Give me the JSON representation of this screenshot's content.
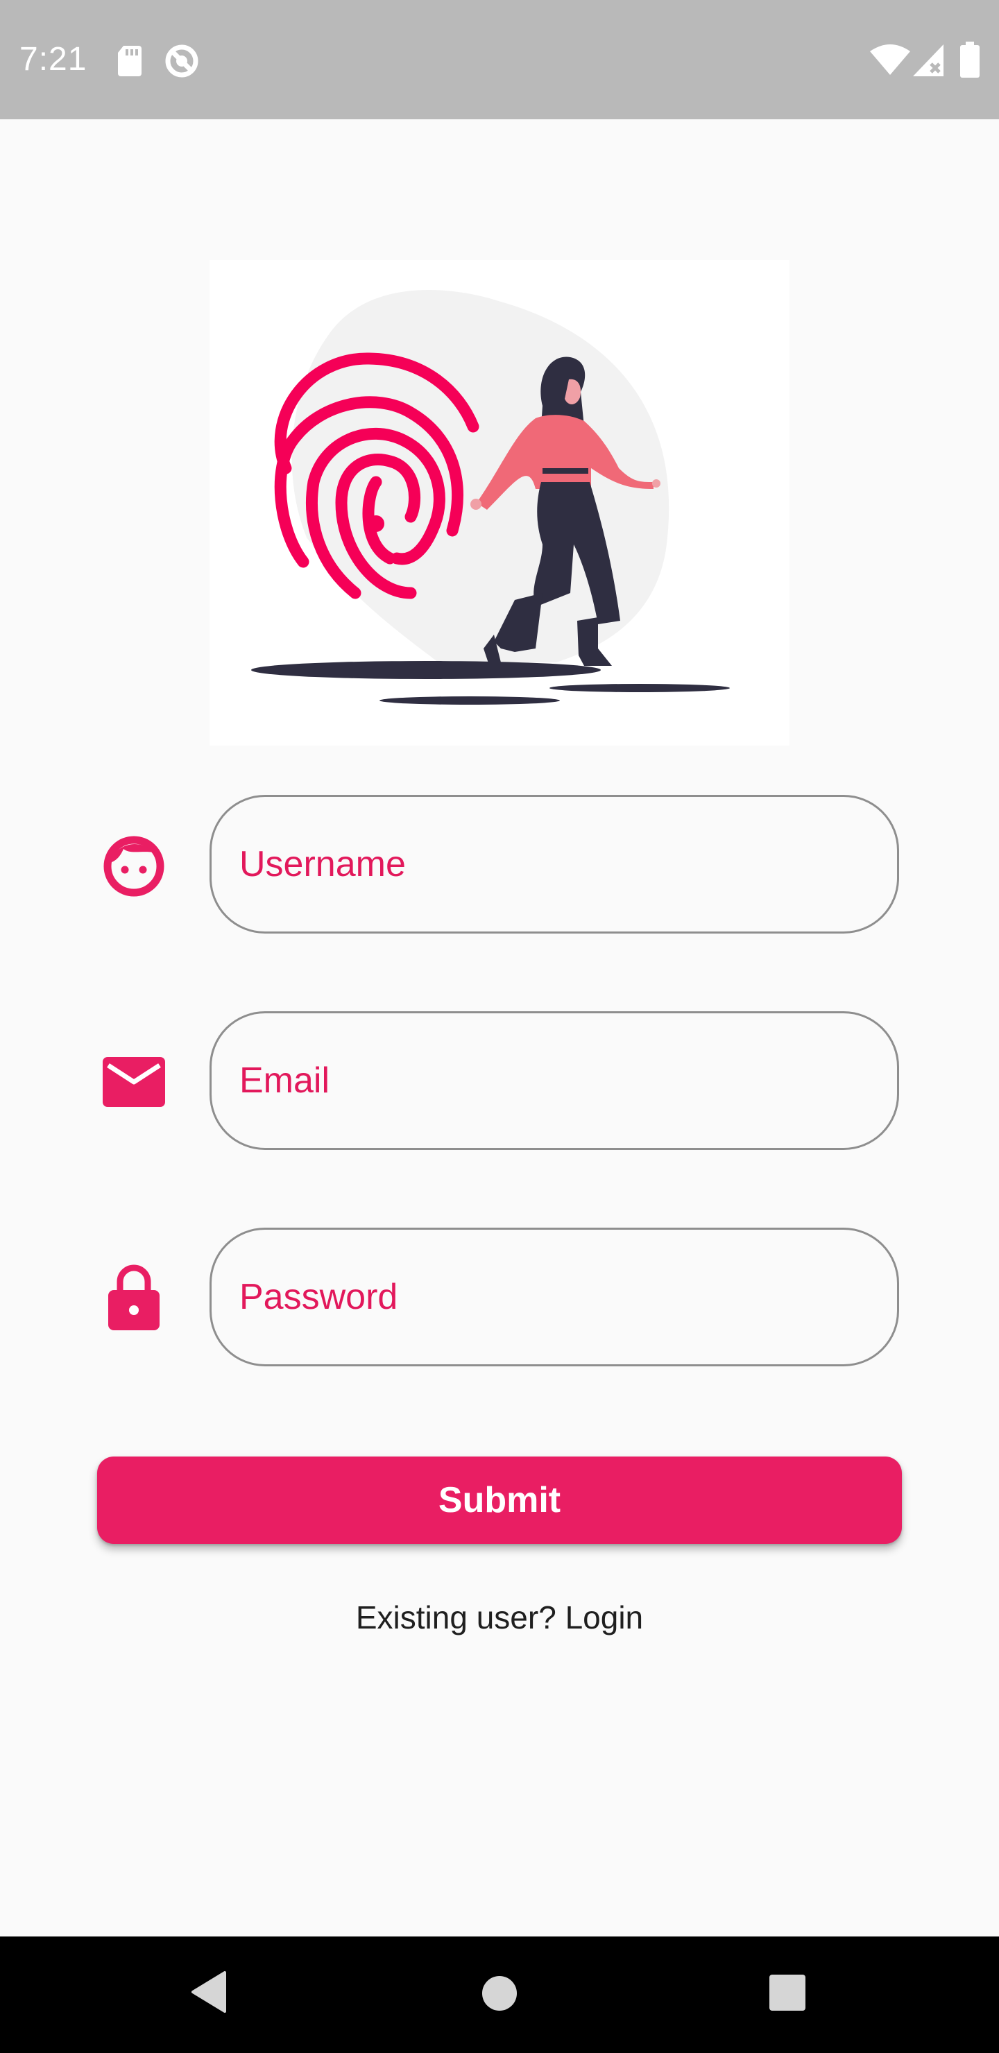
{
  "status_bar": {
    "time": "7:21",
    "icons": [
      "sd-card-icon",
      "do-not-disturb-icon",
      "wifi-icon",
      "signal-icon",
      "battery-icon"
    ]
  },
  "illustration": {
    "name": "fingerprint-woman-illustration",
    "colors": {
      "accent": "#f50057",
      "shirt": "#f06977",
      "dark": "#2f2e41",
      "blob": "#f2f2f2"
    }
  },
  "form": {
    "username": {
      "placeholder": "Username",
      "icon": "face-icon"
    },
    "email": {
      "placeholder": "Email",
      "icon": "mail-icon"
    },
    "password": {
      "placeholder": "Password",
      "icon": "lock-icon"
    }
  },
  "submit_label": "Submit",
  "login_link": "Existing user? Login",
  "nav": {
    "icons": [
      "back-icon",
      "home-icon",
      "recents-icon"
    ]
  },
  "colors": {
    "brand": "#e91e63",
    "placeholder": "#e2185b",
    "field_border": "#8e8e8e",
    "background": "#fafafa",
    "status_bar": "#b9b9b9"
  }
}
